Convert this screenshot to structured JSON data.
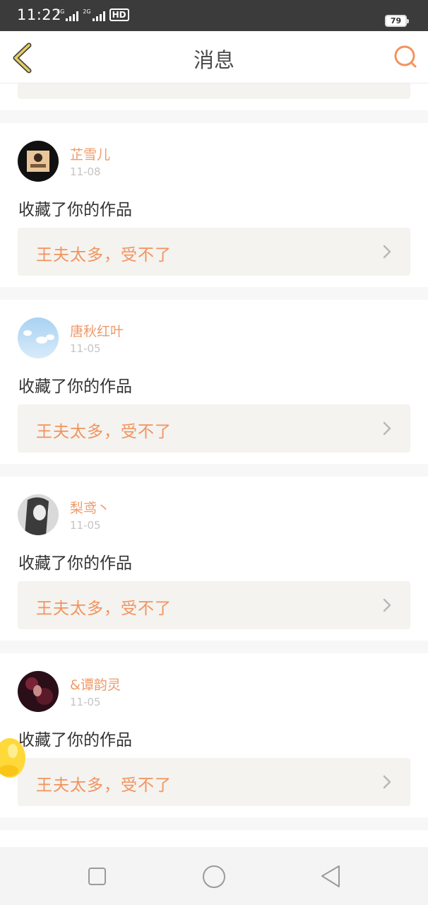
{
  "status_bar": {
    "time": "11:22",
    "net1_tag": "4G",
    "net2_tag": "2G",
    "hd_label": "HD",
    "battery": "79"
  },
  "header": {
    "title": "消息",
    "back_icon": "chevron-left-icon",
    "search_icon": "search-icon"
  },
  "messages": [
    {
      "user": "芷雪儿",
      "date": "11-08",
      "action": "收藏了你的作品",
      "work_title": "王夫太多，受不了"
    },
    {
      "user": "唐秋红叶",
      "date": "11-05",
      "action": "收藏了你的作品",
      "work_title": "王夫太多，受不了"
    },
    {
      "user": "梨鸢丶",
      "date": "11-05",
      "action": "收藏了你的作品",
      "work_title": "王夫太多，受不了"
    },
    {
      "user": "&谭韵灵",
      "date": "11-05",
      "action": "收藏了你的作品",
      "work_title": "王夫太多，受不了"
    }
  ],
  "colors": {
    "accent": "#f2935f",
    "username": "#ef9a68",
    "link_bg": "#f4f3ef",
    "back_icon": "#e2c55a"
  },
  "navbar": {
    "icons": [
      "square-icon",
      "circle-icon",
      "triangle-back-icon"
    ]
  }
}
